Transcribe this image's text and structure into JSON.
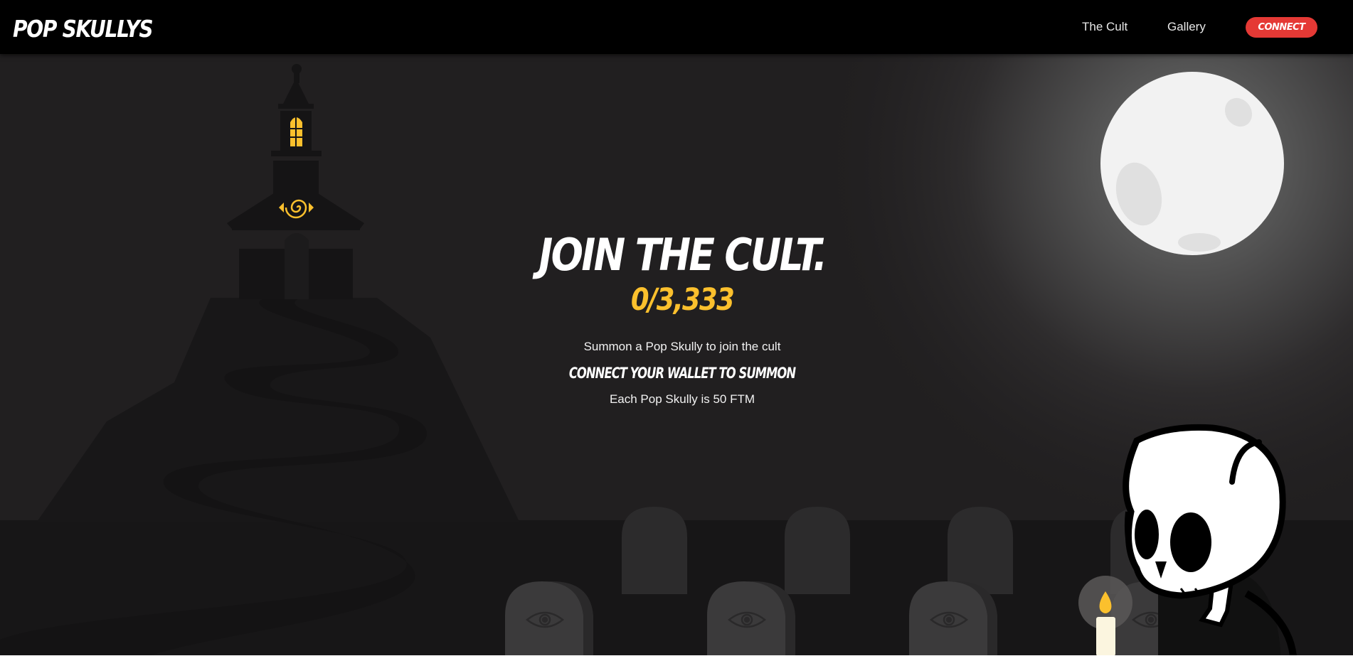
{
  "brand": {
    "logo_text": "POP SKULLYS"
  },
  "nav": {
    "links": [
      {
        "label": "The Cult"
      },
      {
        "label": "Gallery"
      }
    ],
    "connect_label": "CONNECT"
  },
  "hero": {
    "title": "JOIN THE CULT.",
    "mint_count": "0/3,333",
    "description": "Summon a Pop Skully to join the cult",
    "wallet_prompt": "CONNECT YOUR WALLET TO SUMMON",
    "price_text": "Each Pop Skully is 50 FTM"
  },
  "scene": {
    "icons": [
      "church-icon",
      "spiral-eye-icon",
      "moon-icon",
      "tombstone-icon",
      "eye-icon",
      "candle-icon",
      "skeleton-icon"
    ]
  },
  "colors": {
    "navbar_bg": "#000000",
    "hero_bg": "#211f20",
    "accent_red": "#e53935",
    "accent_yellow": "#fbc02d",
    "moon": "#f2f2f2"
  }
}
